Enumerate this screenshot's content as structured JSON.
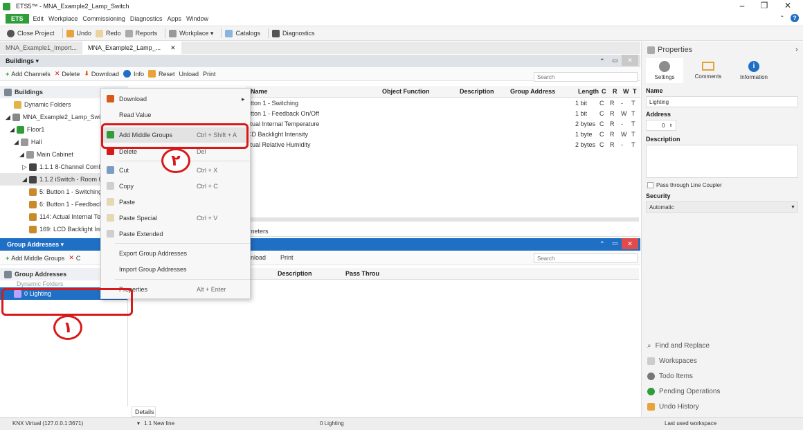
{
  "window": {
    "title": "ETS5™ - MNA_Example2_Lamp_Switch"
  },
  "menubar": {
    "brand": "ETS",
    "items": [
      "Edit",
      "Workplace",
      "Commissioning",
      "Diagnostics",
      "Apps",
      "Window"
    ]
  },
  "toolbar": {
    "close_project": "Close Project",
    "undo": "Undo",
    "redo": "Redo",
    "reports": "Reports",
    "workplace": "Workplace ▾",
    "catalogs": "Catalogs",
    "diagnostics": "Diagnostics"
  },
  "doc_tabs": [
    "MNA_Example1_Import...",
    "MNA_Example2_Lamp_..."
  ],
  "buildings": {
    "header": "Buildings ▾",
    "toolbar": {
      "add_channels": "Add Channels",
      "delete": "Delete",
      "download": "Download",
      "info": "Info",
      "reset": "Reset",
      "unload": "Unload",
      "print": "Print",
      "search_placeholder": "Search"
    },
    "tree": [
      "Buildings",
      "Dynamic Folders",
      "MNA_Example2_Lamp_Swit",
      "Floor1",
      "Hall",
      "Main Cabinet",
      "1.1.1 8-Channel Comb",
      "1.1.2 iSwitch - Room Co",
      "5: Button 1 - Switching",
      "6: Button 1 - Feedback",
      "114: Actual Internal Te",
      "169: LCD Backlight Int"
    ],
    "columns": [
      "Name",
      "Object Function",
      "Description",
      "Group Address",
      "Length",
      "C",
      "R",
      "W",
      "T"
    ],
    "rows": [
      {
        "name": "utton 1 - Switching",
        "length": "1 bit",
        "c": "C",
        "r": "R",
        "w": "-",
        "t": "T"
      },
      {
        "name": "utton 1 - Feedback On/Off",
        "length": "1 bit",
        "c": "C",
        "r": "R",
        "w": "W",
        "t": "T"
      },
      {
        "name": "ctual Internal Temperature",
        "length": "2 bytes",
        "c": "C",
        "r": "R",
        "w": "-",
        "t": "T"
      },
      {
        "name": "CD Backlight Intensity",
        "length": "1 byte",
        "c": "C",
        "r": "R",
        "w": "W",
        "t": "T"
      },
      {
        "name": "ctual Relative Humidity",
        "length": "2 bytes",
        "c": "C",
        "r": "R",
        "w": "-",
        "t": "T"
      }
    ],
    "bottom_tab": "meters"
  },
  "group_addresses": {
    "header": "Group Addresses ▾",
    "toolbar": {
      "add_middle_groups": "Add Middle Groups",
      "delete_short": "C",
      "unload": "nload",
      "print": "Print",
      "search_placeholder": "Search"
    },
    "tree": [
      "Group Addresses",
      "Dynamic Folders",
      "0 Lighting"
    ],
    "columns": [
      "Description",
      "Pass Throu"
    ],
    "details_tab": "Details"
  },
  "context_menu": {
    "items": [
      {
        "label": "Download",
        "shortcut": "",
        "enabled": true,
        "submenu": true
      },
      {
        "label": "Read Value",
        "shortcut": "",
        "enabled": false
      },
      {
        "label": "Add Middle Groups",
        "shortcut": "Ctrl + Shift + A",
        "enabled": true,
        "highlight": true
      },
      {
        "label": "Delete",
        "shortcut": "Del",
        "enabled": true
      },
      {
        "label": "Cut",
        "shortcut": "Ctrl + X",
        "enabled": true
      },
      {
        "label": "Copy",
        "shortcut": "Ctrl + C",
        "enabled": true
      },
      {
        "label": "Paste",
        "shortcut": "",
        "enabled": false
      },
      {
        "label": "Paste Special",
        "shortcut": "Ctrl + V",
        "enabled": false
      },
      {
        "label": "Paste Extended",
        "shortcut": "",
        "enabled": false
      },
      {
        "label": "Export Group Addresses",
        "shortcut": "",
        "enabled": true
      },
      {
        "label": "Import Group Addresses",
        "shortcut": "",
        "enabled": true
      },
      {
        "label": "Properties",
        "shortcut": "Alt + Enter",
        "enabled": true
      }
    ]
  },
  "annotations": {
    "one": "١",
    "two": "٢"
  },
  "properties": {
    "title": "Properties",
    "tabs": [
      "Settings",
      "Comments",
      "Information"
    ],
    "name_label": "Name",
    "name_value": "Lighting",
    "address_label": "Address",
    "address_value": "0",
    "description_label": "Description",
    "pass_through": "Pass through Line Coupler",
    "security_label": "Security",
    "security_value": "Automatic",
    "links": [
      "Find and Replace",
      "Workspaces",
      "Todo Items",
      "Pending Operations",
      "Undo History"
    ]
  },
  "status": {
    "connection": "KNX Virtual (127.0.0.1:3671)",
    "line": "1.1 New line",
    "selection": "0 Lighting",
    "workspace": "Last used workspace"
  },
  "colors": {
    "accent": "#1f6fc5",
    "brand_green": "#2e9d3a",
    "annotation_red": "#d81919"
  }
}
